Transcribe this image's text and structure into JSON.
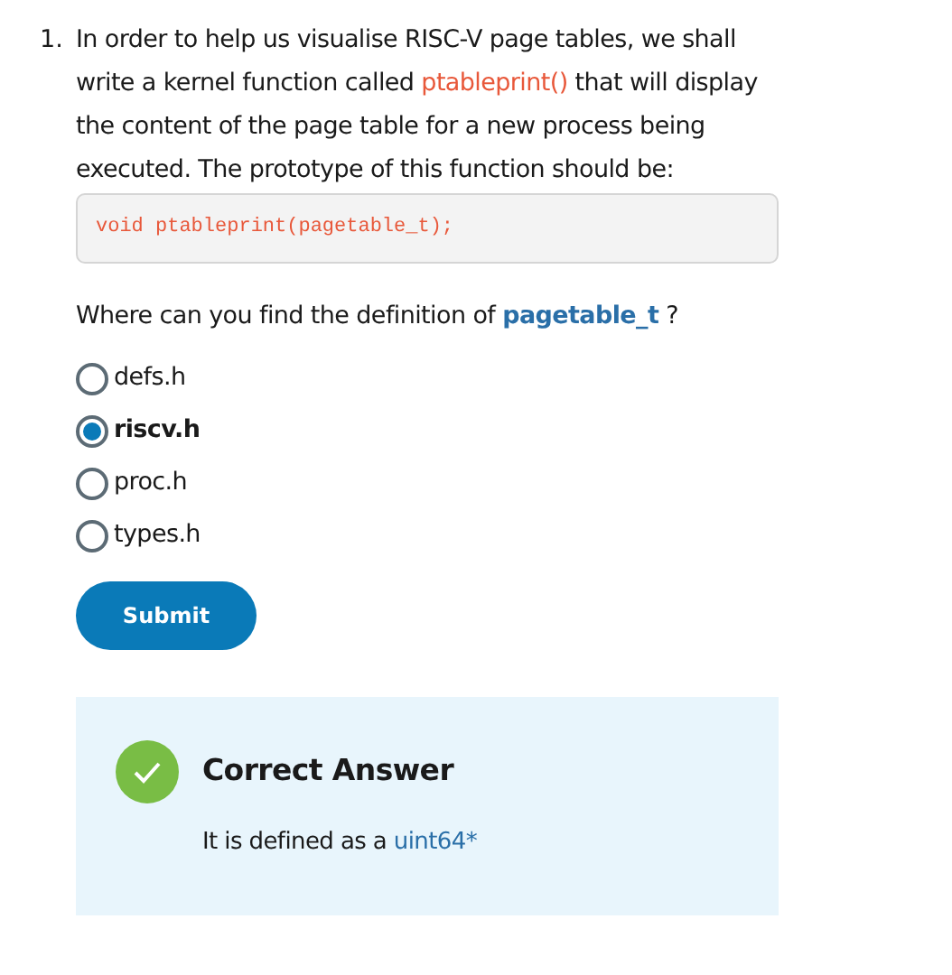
{
  "question": {
    "number": "1.",
    "intro": [
      {
        "kind": "text",
        "text": "In order to help us visualise RISC-V page tables, we shall write a kernel function called "
      },
      {
        "kind": "code",
        "text": "ptableprint()"
      },
      {
        "kind": "text",
        "text": " that will display the content of the page table for a new process being executed. The prototype of this function should be:"
      }
    ],
    "code_block": "void ptableprint(pagetable_t);",
    "prompt": [
      {
        "kind": "text",
        "text": "Where can you find the definition of "
      },
      {
        "kind": "term",
        "text": "pagetable_t"
      },
      {
        "kind": "text",
        "text": " ?"
      }
    ],
    "options": [
      {
        "label": "defs.h",
        "selected": false
      },
      {
        "label": "riscv.h",
        "selected": true
      },
      {
        "label": "proc.h",
        "selected": false
      },
      {
        "label": "types.h",
        "selected": false
      }
    ],
    "submit": "Submit"
  },
  "feedback": {
    "title": "Correct Answer",
    "correct": true,
    "message": [
      {
        "kind": "text",
        "text": "It is defined as a "
      },
      {
        "kind": "term",
        "text": "uint64*"
      }
    ]
  }
}
